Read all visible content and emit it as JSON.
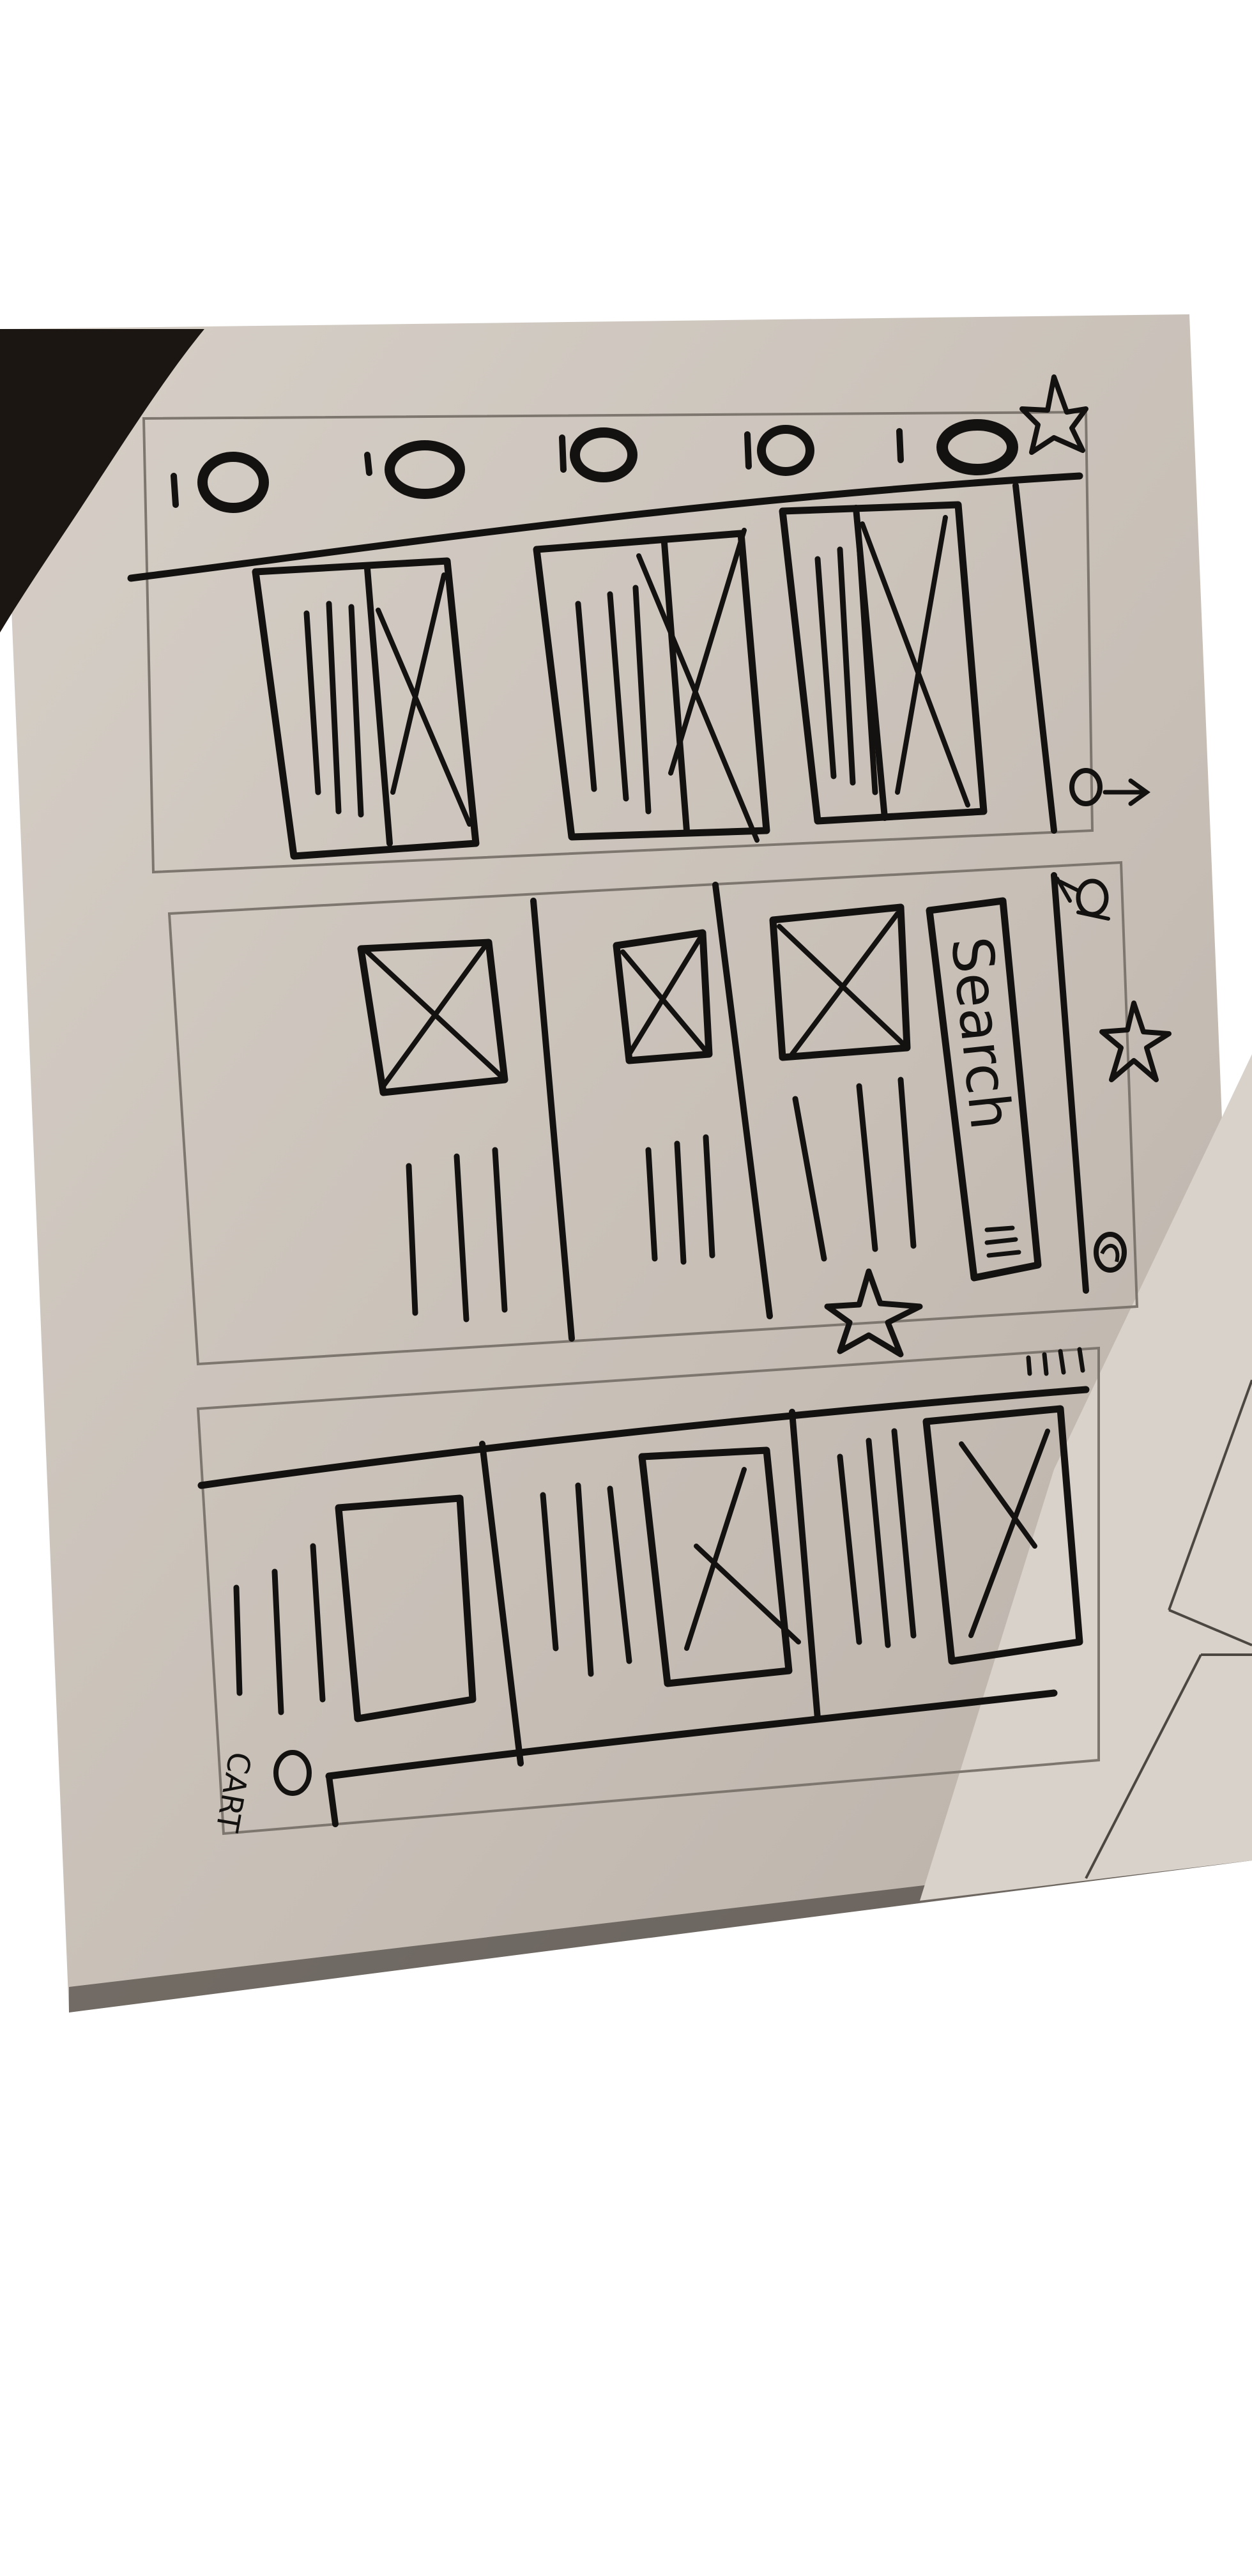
{
  "colors": {
    "page_background": "#ffffff",
    "paper": "#cfc8c0",
    "paper_shadow": "#b7afa6",
    "ink": "#141210",
    "frame": "#7d766f",
    "dark_object": "#1b1612",
    "loose_sheet": "#d8d2cb"
  },
  "wireframe": {
    "panel_1": {
      "icons": [
        "circle-icon",
        "circle-icon",
        "circle-icon",
        "circle-icon",
        "circle-icon",
        "star-icon",
        "arrow-icon"
      ],
      "image_placeholders": 3
    },
    "panel_2": {
      "search_label": "Search",
      "icons": [
        "profile-icon",
        "star-icon",
        "star-icon",
        "circle-icon"
      ],
      "image_placeholders": 3
    },
    "panel_3": {
      "cart_label": "CART",
      "icons": [
        "cart-icon"
      ],
      "image_placeholders": 3
    }
  }
}
